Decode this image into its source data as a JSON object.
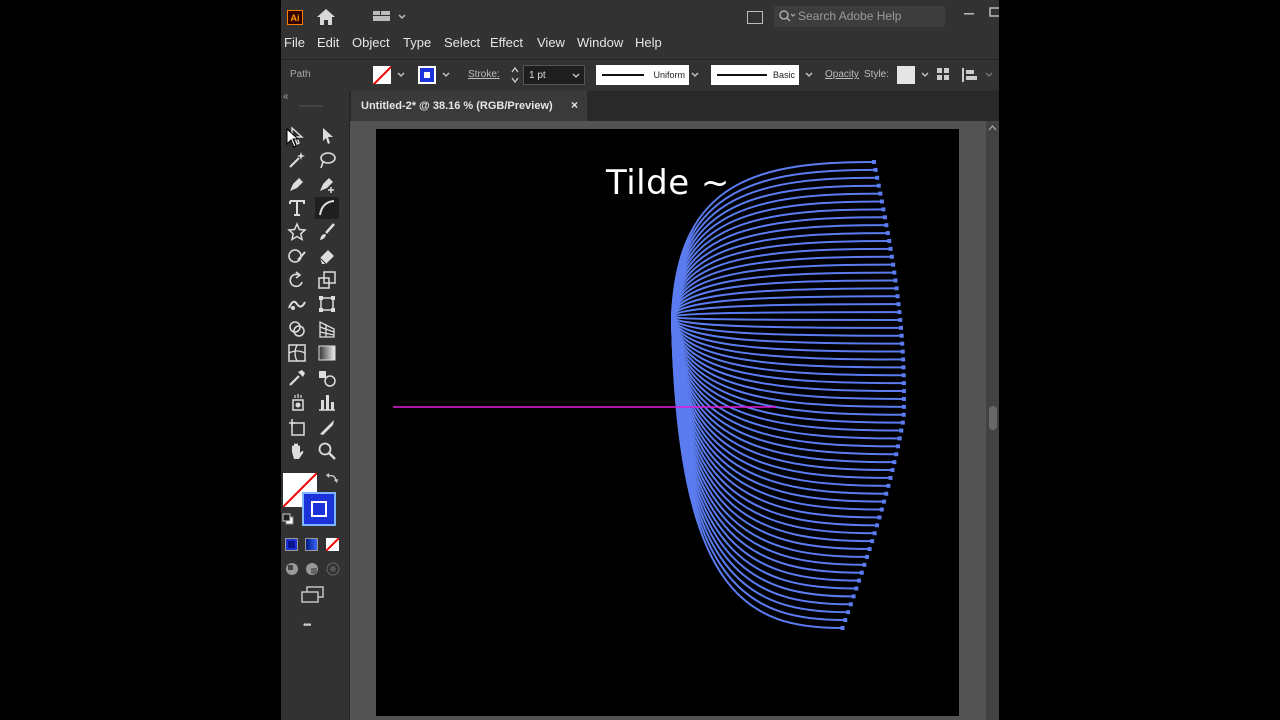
{
  "app": {
    "logo_text": "Ai"
  },
  "search": {
    "placeholder": "Search Adobe Help"
  },
  "menu": [
    "File",
    "Edit",
    "Object",
    "Type",
    "Select",
    "Effect",
    "View",
    "Window",
    "Help"
  ],
  "control_bar": {
    "selection_label": "Path",
    "stroke_label": "Stroke:",
    "stroke_weight": "1 pt",
    "profile_label": "Uniform",
    "brush_label": "Basic",
    "opacity_label": "Opacity",
    "style_label": "Style:"
  },
  "document": {
    "tab_title": "Untitled-2* @ 38.16 % (RGB/Preview)",
    "close_glyph": "×"
  },
  "artboard": {
    "text": "Tilde ~",
    "blend_color": "#5b7cf0",
    "path_color": "#e11ad8"
  },
  "toolbar": {
    "more_glyph": "•••",
    "collapse_glyph": "«"
  },
  "colors": {
    "fill": "#ffffff",
    "stroke": "#1a32d8"
  }
}
